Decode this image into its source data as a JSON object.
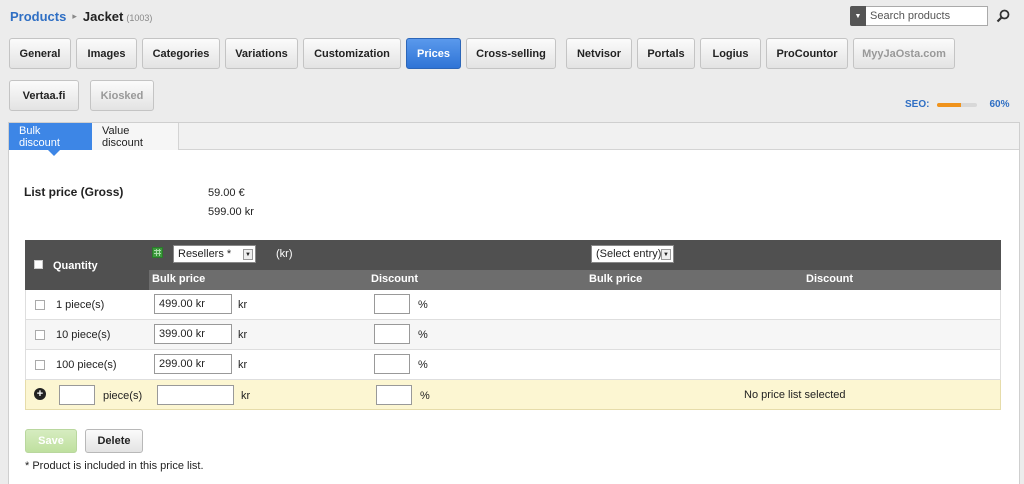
{
  "breadcrumb": {
    "root": "Products",
    "separator": "▸",
    "current": "Jacket",
    "count": "(1003)"
  },
  "search": {
    "placeholder": "Search products",
    "toggle_icon": "caret-down-icon",
    "button_icon": "magnifier-icon"
  },
  "tabs": [
    {
      "label": "General",
      "state": "normal"
    },
    {
      "label": "Images",
      "state": "normal"
    },
    {
      "label": "Categories",
      "state": "normal"
    },
    {
      "label": "Variations",
      "state": "normal"
    },
    {
      "label": "Customization",
      "state": "normal"
    },
    {
      "label": "Prices",
      "state": "active"
    },
    {
      "label": "Cross-selling",
      "state": "normal"
    },
    {
      "label": "Netvisor",
      "state": "normal"
    },
    {
      "label": "Portals",
      "state": "normal"
    },
    {
      "label": "Logius",
      "state": "normal"
    },
    {
      "label": "ProCountor",
      "state": "normal"
    },
    {
      "label": "MyyJaOsta.com",
      "state": "disabled"
    },
    {
      "label": "Vertaa.fi",
      "state": "normal"
    },
    {
      "label": "Kiosked",
      "state": "disabled"
    }
  ],
  "seo": {
    "label": "SEO:",
    "value": "60%",
    "fraction": 0.6,
    "color": "#f0931c"
  },
  "subtabs": [
    "Bulk discount",
    "Value discount"
  ],
  "list_price": {
    "label": "List price (Gross)",
    "eur": "59.00 €",
    "sek": "599.00 kr"
  },
  "grid": {
    "quantity_header": "Quantity",
    "pricelist_select": "Resellers *",
    "currency_note": "(kr)",
    "second_select": "(Select entry)",
    "col_bulk_price": "Bulk price",
    "col_discount": "Discount",
    "col_bulk_price_2": "Bulk price",
    "col_discount_2": "Discount",
    "rows": [
      {
        "qty": "1 piece(s)",
        "price": "499.00 kr",
        "unit": "kr",
        "discount": "",
        "pct": "%"
      },
      {
        "qty": "10 piece(s)",
        "price": "399.00 kr",
        "unit": "kr",
        "discount": "",
        "pct": "%"
      },
      {
        "qty": "100 piece(s)",
        "price": "299.00 kr",
        "unit": "kr",
        "discount": "",
        "pct": "%"
      }
    ],
    "new_row": {
      "unit_label": "piece(s)",
      "kr": "kr",
      "pct": "%",
      "no_list": "No price list selected"
    }
  },
  "buttons": {
    "save": "Save",
    "delete": "Delete"
  },
  "footnote": "* Product is included in this price list.",
  "colors": {
    "accent": "#2f74d6",
    "link": "#2f6fc4",
    "header_bg": "#505050",
    "new_row_bg": "#fcf6d2"
  }
}
